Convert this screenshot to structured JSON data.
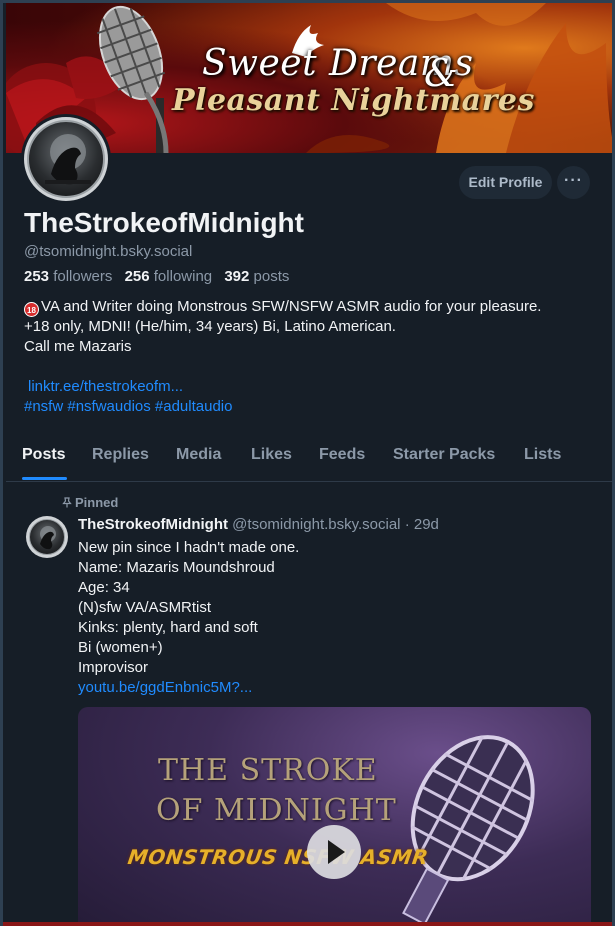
{
  "banner": {
    "title_line1": "Sweet Dreams",
    "ampersand": "&",
    "title_line2": "Pleasant Nightmares"
  },
  "profile": {
    "display_name": "TheStrokeofMidnight",
    "handle": "@tsomidnight.bsky.social",
    "followers_count": "253",
    "followers_label": "followers",
    "following_count": "256",
    "following_label": "following",
    "posts_count": "392",
    "posts_label": "posts",
    "edit_label": "Edit Profile",
    "more_label": "···",
    "bio": {
      "age_badge": "18",
      "line1": "VA and Writer doing Monstrous SFW/NSFW ASMR audio for your pleasure.",
      "line2": "+18 only, MDNI! (He/him, 34 years) Bi, Latino American.",
      "line3": "Call me Mazaris",
      "link": "linktr.ee/thestrokeofm...",
      "hashtags": "#nsfw #nsfwaudios #adultaudio"
    }
  },
  "tabs": [
    "Posts",
    "Replies",
    "Media",
    "Likes",
    "Feeds",
    "Starter Packs",
    "Lists"
  ],
  "post": {
    "pinned_label": "Pinned",
    "author_name": "TheStrokeofMidnight",
    "author_handle": "@tsomidnight.bsky.social",
    "separator": " · ",
    "age": "29d",
    "lines": [
      "New pin since I hadn't made one.",
      "Name: Mazaris Moundshroud",
      "Age: 34",
      "(N)sfw VA/ASMRtist",
      "Kinks: plenty, hard and soft",
      "Bi (women+)",
      "Improvisor"
    ],
    "link": "youtu.be/ggdEnbnic5M?...",
    "embed": {
      "line1": "THE STROKE",
      "line2": "OF MIDNIGHT",
      "line3": "MONSTROUS NSFW ASMR"
    }
  },
  "colors": {
    "background": "#161e27",
    "accent": "#208bfe",
    "muted_text": "#8c99a8"
  }
}
